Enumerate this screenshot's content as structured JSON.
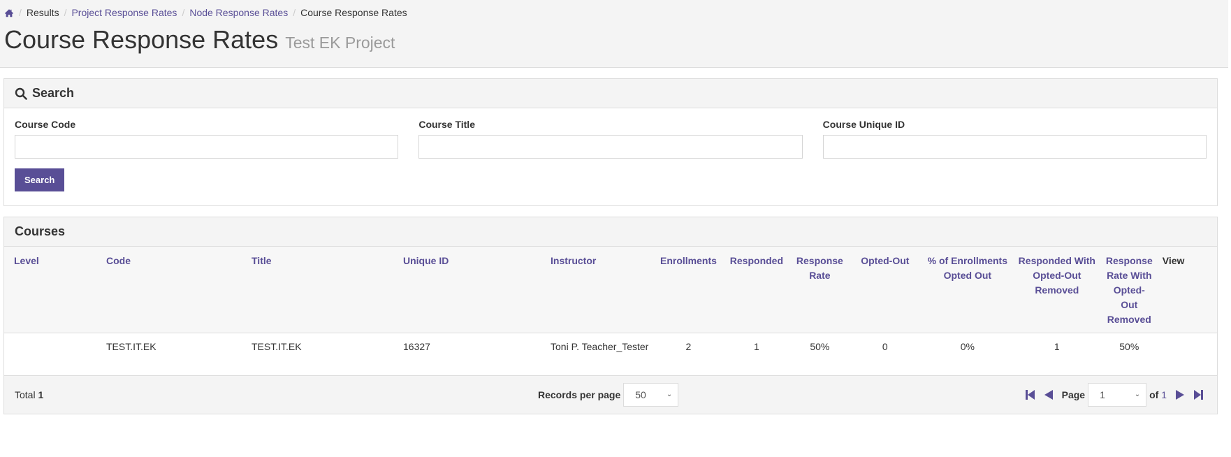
{
  "breadcrumb": {
    "home_icon": "home-icon",
    "items": [
      {
        "label": "Results",
        "link": false
      },
      {
        "label": "Project Response Rates",
        "link": true
      },
      {
        "label": "Node Response Rates",
        "link": true
      },
      {
        "label": "Course Response Rates",
        "link": false
      }
    ]
  },
  "header": {
    "title": "Course Response Rates",
    "subtitle": "Test EK Project"
  },
  "search": {
    "heading": "Search",
    "icon": "search-icon",
    "fields": [
      {
        "label": "Course Code",
        "value": "",
        "placeholder": ""
      },
      {
        "label": "Course Title",
        "value": "",
        "placeholder": ""
      },
      {
        "label": "Course Unique ID",
        "value": "",
        "placeholder": ""
      }
    ],
    "button_label": "Search"
  },
  "courses": {
    "heading": "Courses",
    "columns": [
      "Level",
      "Code",
      "Title",
      "Unique ID",
      "Instructor",
      "Enrollments",
      "Responded",
      "Response Rate",
      "Opted-Out",
      "% of Enrollments Opted Out",
      "Responded With Opted-Out Removed",
      "Response Rate With Opted-Out Removed",
      "View"
    ],
    "rows": [
      {
        "level": "",
        "code": "TEST.IT.EK",
        "title": "TEST.IT.EK",
        "unique_id": "16327",
        "instructor": "Toni P. Teacher_Tester",
        "enrollments": "2",
        "responded": "1",
        "response_rate": "50%",
        "opted_out": "0",
        "pct_opted_out": "0%",
        "responded_opted_removed": "1",
        "rate_opted_removed": "50%",
        "view": ""
      }
    ],
    "footer": {
      "total_label": "Total",
      "total_value": "1",
      "records_per_page_label": "Records per page",
      "records_per_page": "50",
      "page_label": "Page",
      "page": "1",
      "of_label": "of",
      "page_count": "1"
    }
  },
  "colors": {
    "accent": "#594e96",
    "header_bg": "#f4f4f4",
    "border": "#dddddd"
  }
}
